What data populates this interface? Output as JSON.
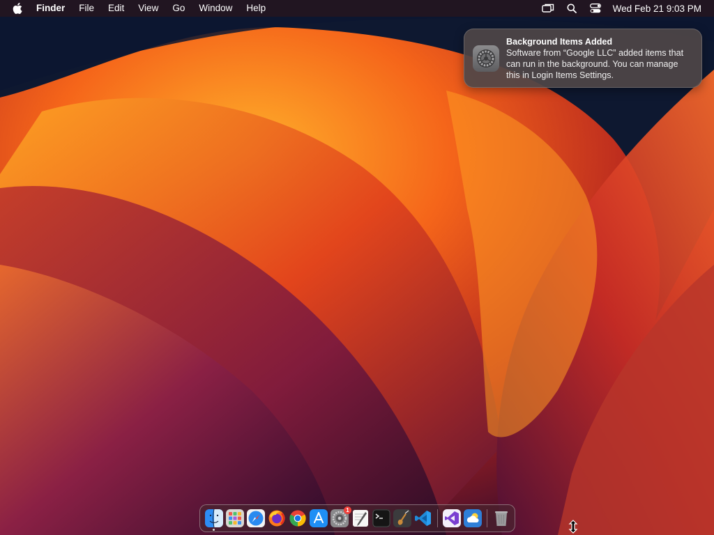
{
  "menubar": {
    "apple_icon": "apple-logo-icon",
    "app_name": "Finder",
    "menus": [
      "File",
      "Edit",
      "View",
      "Go",
      "Window",
      "Help"
    ],
    "status_icons": [
      "screen-mirroring-icon",
      "spotlight-search-icon",
      "control-center-icon"
    ],
    "clock": "Wed Feb 21  9:03 PM"
  },
  "notification": {
    "app_icon": "system-settings-gear-icon",
    "title": "Background Items Added",
    "body": "Software from “Google LLC” added items that can run in the background. You can manage this in Login Items Settings."
  },
  "dock": {
    "apps": [
      {
        "name": "Finder",
        "icon": "finder-icon",
        "running": true
      },
      {
        "name": "Launchpad",
        "icon": "launchpad-icon",
        "running": false
      },
      {
        "name": "Safari",
        "icon": "safari-icon",
        "running": false
      },
      {
        "name": "Firefox",
        "icon": "firefox-icon",
        "running": false
      },
      {
        "name": "Google Chrome",
        "icon": "chrome-icon",
        "running": false
      },
      {
        "name": "App Store",
        "icon": "app-store-icon",
        "running": false
      },
      {
        "name": "System Settings",
        "icon": "system-settings-icon",
        "running": false,
        "badge": "1"
      },
      {
        "name": "TextEdit",
        "icon": "textedit-icon",
        "running": false
      },
      {
        "name": "Terminal",
        "icon": "terminal-icon",
        "running": false
      },
      {
        "name": "Instruments",
        "icon": "instruments-icon",
        "running": false
      },
      {
        "name": "Visual Studio Code",
        "icon": "vscode-icon",
        "running": false
      }
    ],
    "extras": [
      {
        "name": "Visual Studio",
        "icon": "visual-studio-icon"
      },
      {
        "name": "Weather",
        "icon": "weather-icon"
      }
    ],
    "trash": {
      "name": "Trash",
      "icon": "trash-icon"
    }
  },
  "cursor": "resize-vertical-cursor-icon"
}
